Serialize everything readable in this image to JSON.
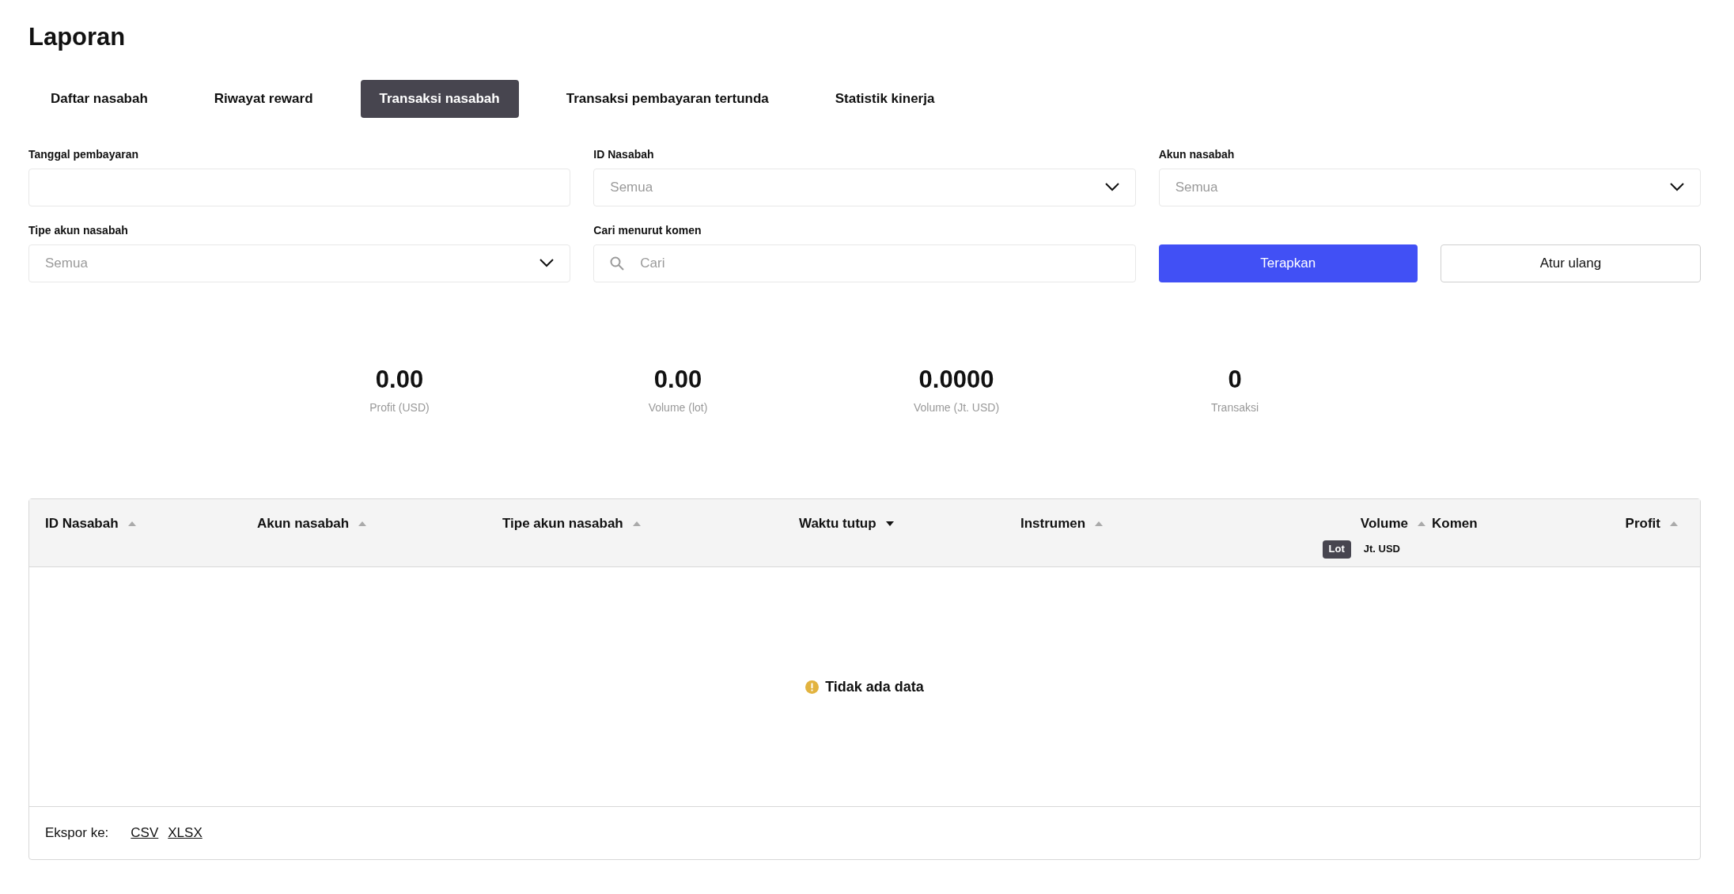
{
  "title": "Laporan",
  "tabs": [
    {
      "label": "Daftar nasabah",
      "selected": false
    },
    {
      "label": "Riwayat reward",
      "selected": false
    },
    {
      "label": "Transaksi nasabah",
      "selected": true
    },
    {
      "label": "Transaksi pembayaran tertunda",
      "selected": false
    },
    {
      "label": "Statistik kinerja",
      "selected": false
    }
  ],
  "filters": [
    {
      "kind": "date",
      "label": "Tanggal pembayaran"
    },
    {
      "kind": "select",
      "label": "ID Nasabah",
      "placeholder": "Semua"
    },
    {
      "kind": "select",
      "label": "Akun nasabah",
      "placeholder": "Semua"
    },
    {
      "kind": "select",
      "label": "Tipe akun nasabah",
      "placeholder": "Semua"
    },
    {
      "kind": "search",
      "label": "Cari menurut komen",
      "placeholder": "Cari"
    }
  ],
  "buttons": [
    {
      "kind": "primary",
      "label": "Terapkan"
    },
    {
      "kind": "secondary",
      "label": "Atur ulang"
    }
  ],
  "stats": [
    {
      "value": "0.00",
      "label": "Profit (USD)"
    },
    {
      "value": "0.00",
      "label": "Volume (lot)"
    },
    {
      "value": "0.0000",
      "label": "Volume (Jt. USD)"
    },
    {
      "value": "0",
      "label": "Transaksi"
    }
  ],
  "table": {
    "columns": [
      {
        "kind": "text",
        "label": "ID Nasabah",
        "sort_active": false
      },
      {
        "kind": "text",
        "label": "Akun nasabah",
        "sort_active": false
      },
      {
        "kind": "text",
        "label": "Tipe akun nasabah",
        "sort_active": false
      },
      {
        "kind": "text",
        "label": "Waktu tutup",
        "sort_active": true
      },
      {
        "kind": "text",
        "label": "Instrumen",
        "sort_active": false
      },
      {
        "kind": "numeric",
        "label": "Volume",
        "sort_active": false,
        "units": [
          {
            "label": "Lot",
            "selected": true
          },
          {
            "label": "Jt. USD",
            "selected": false
          }
        ]
      },
      {
        "kind": "plain",
        "label": "Komen"
      },
      {
        "kind": "numeric",
        "label": "Profit",
        "sort_active": false
      }
    ],
    "empty_text": "Tidak ada data"
  },
  "export": {
    "label": "Ekspor ke:",
    "links": [
      "CSV",
      "XLSX"
    ]
  }
}
